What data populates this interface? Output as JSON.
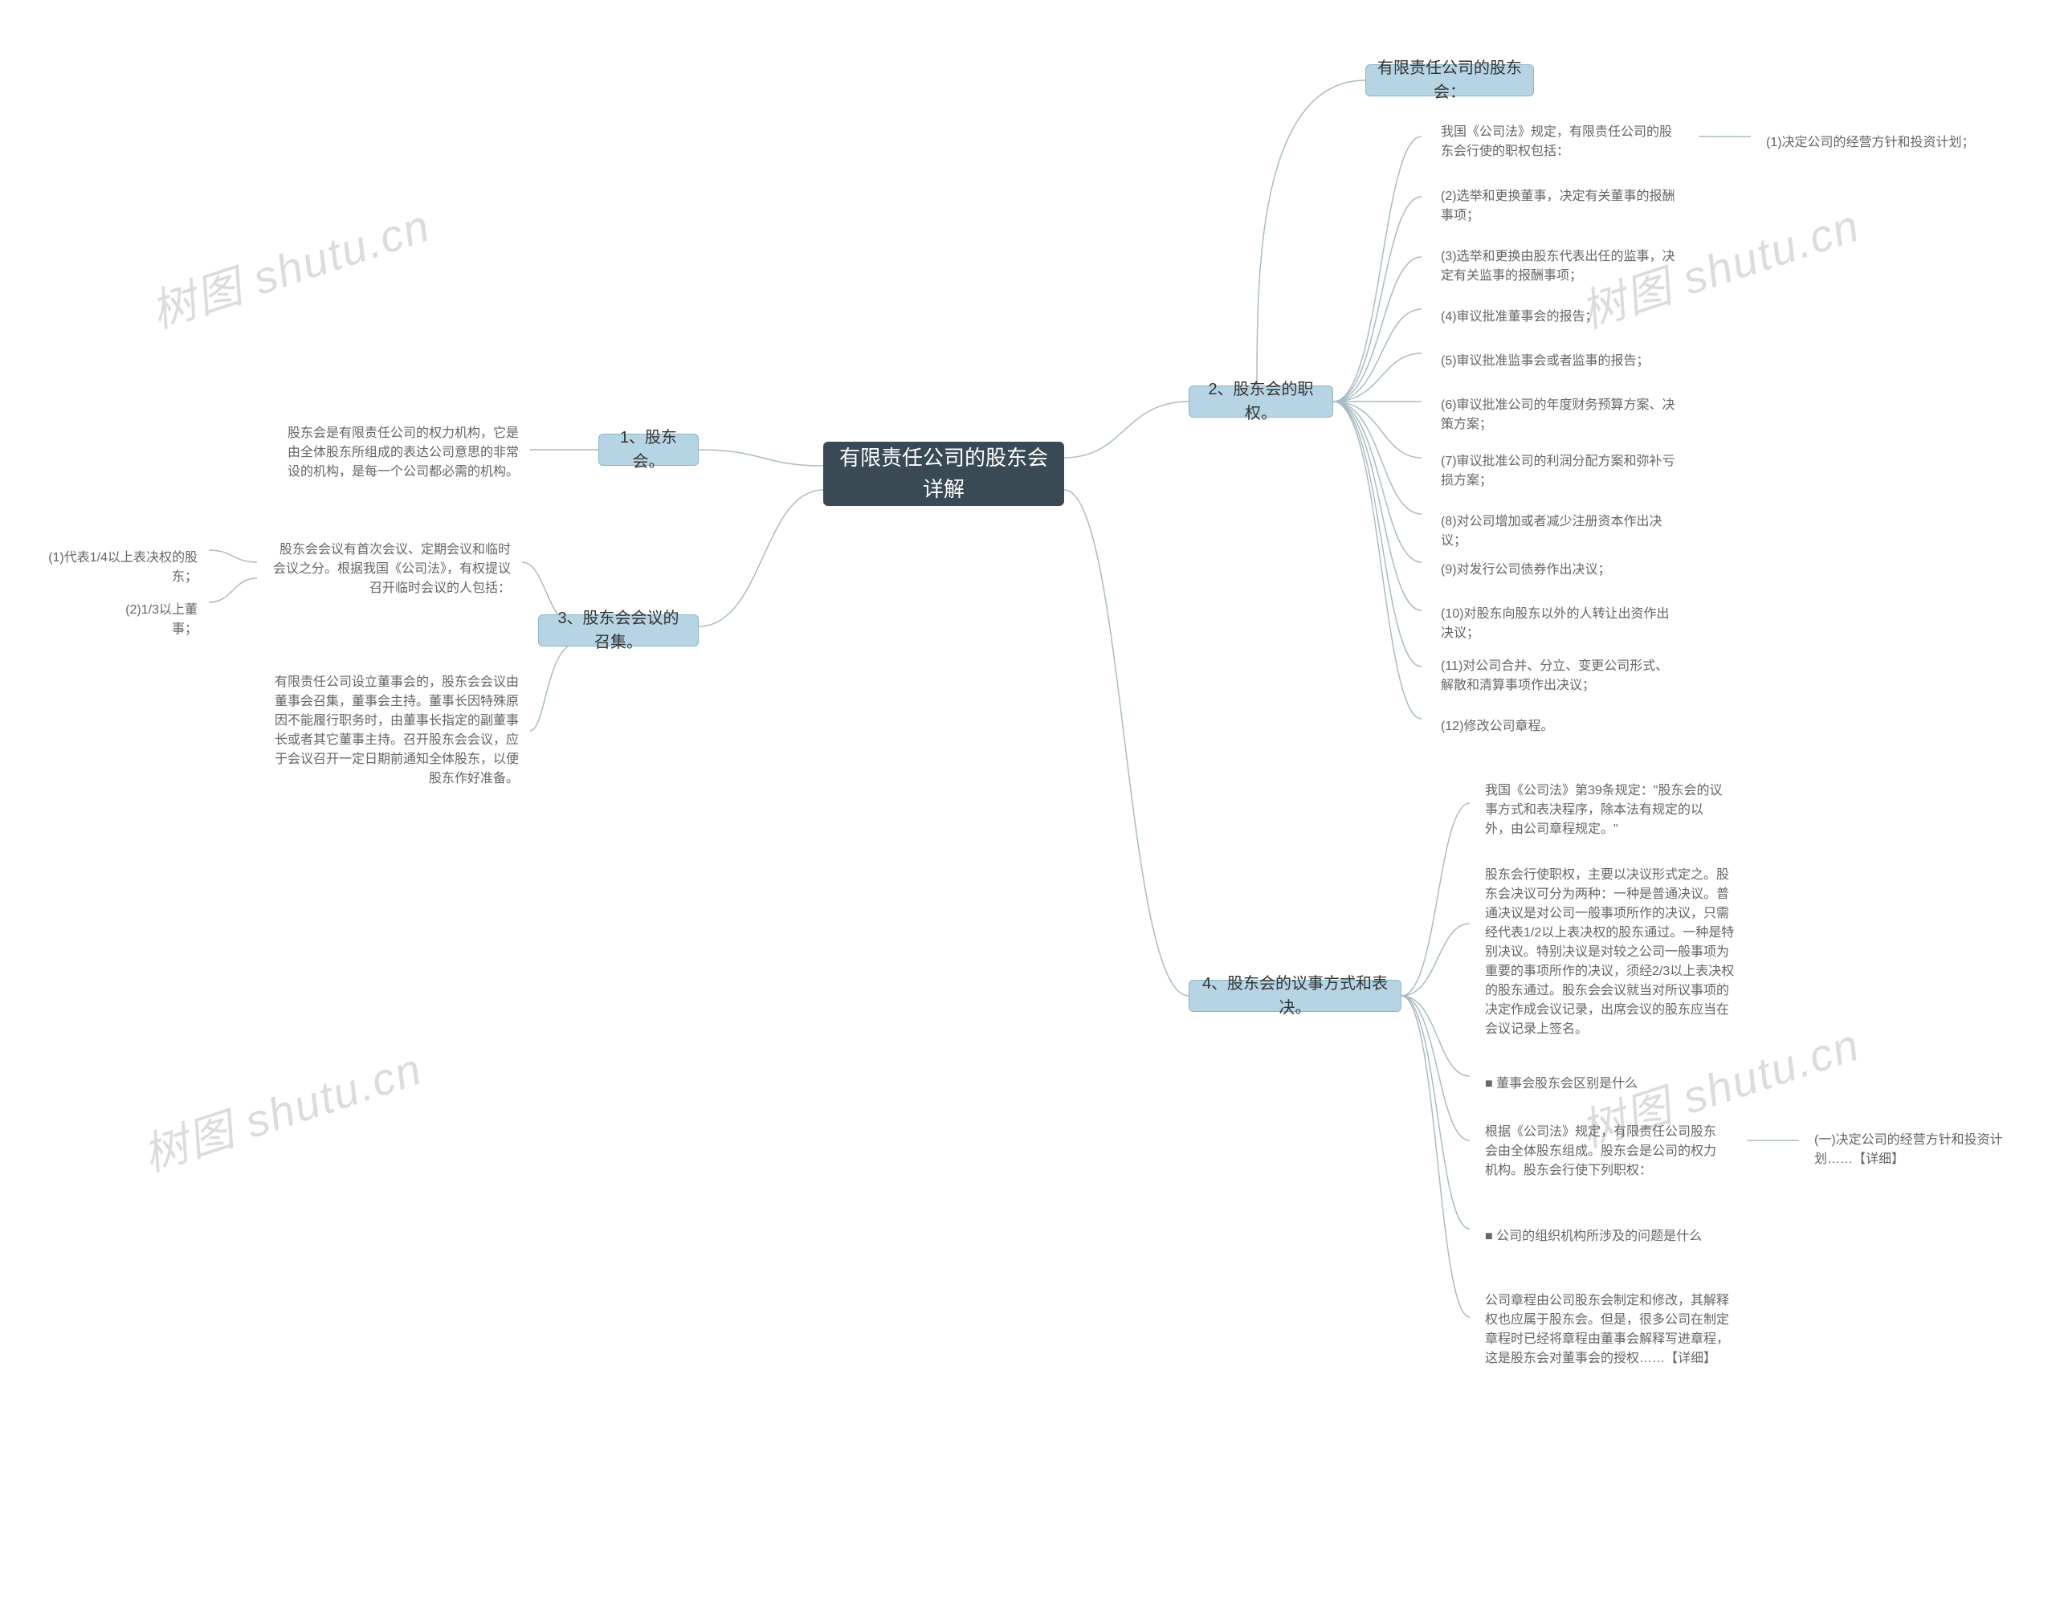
{
  "watermark": "树图 shutu.cn",
  "root": {
    "title": "有限责任公司的股东会详解"
  },
  "branches": {
    "b1": {
      "label": "1、股东会。"
    },
    "b2": {
      "label": "2、股东会的职权。"
    },
    "b3": {
      "label": "3、股东会会议的召集。"
    },
    "b4": {
      "label": "4、股东会的议事方式和表决。"
    },
    "b2a": {
      "label": "有限责任公司的股东会："
    }
  },
  "b1_children": {
    "c1": "股东会是有限责任公司的权力机构，它是由全体股东所组成的表达公司意思的非常设的机构，是每一个公司都必需的机构。"
  },
  "b3_children": {
    "c1": "股东会会议有首次会议、定期会议和临时会议之分。根据我国《公司法》，有权提议召开临时会议的人包括：",
    "c1a": "(1)代表1/4以上表决权的股东；",
    "c1b": "(2)1/3以上董事；",
    "c2": "有限责任公司设立董事会的，股东会会议由董事会召集，董事会主持。董事长因特殊原因不能履行职务时，由董事长指定的副董事长或者其它董事主持。召开股东会会议，应于会议召开一定日期前通知全体股东，以便股东作好准备。"
  },
  "b2_children": {
    "intro": "我国《公司法》规定，有限责任公司的股东会行使的职权包括：",
    "p1": "(1)决定公司的经营方针和投资计划；",
    "p2": "(2)选举和更换董事，决定有关董事的报酬事项；",
    "p3": "(3)选举和更换由股东代表出任的监事，决定有关监事的报酬事项；",
    "p4": "(4)审议批准董事会的报告；",
    "p5": "(5)审议批准监事会或者监事的报告；",
    "p6": "(6)审议批准公司的年度财务预算方案、决策方案；",
    "p7": "(7)审议批准公司的利润分配方案和弥补亏损方案；",
    "p8": "(8)对公司增加或者减少注册资本作出决议；",
    "p9": "(9)对发行公司债券作出决议；",
    "p10": "(10)对股东向股东以外的人转让出资作出决议；",
    "p11": "(11)对公司合并、分立、变更公司形式、解散和清算事项作出决议；",
    "p12": "(12)修改公司章程。"
  },
  "b4_children": {
    "c1": "我国《公司法》第39条规定：\"股东会的议事方式和表决程序，除本法有规定的以外，由公司章程规定。\"",
    "c2": "股东会行使职权，主要以决议形式定之。股东会决议可分为两种：一种是普通决议。普通决议是对公司一般事项所作的决议，只需经代表1/2以上表决权的股东通过。一种是特别决议。特别决议是对较之公司一般事项为重要的事项所作的决议，须经2/3以上表决权的股东通过。股东会会议就当对所议事项的决定作成会议记录，出席会议的股东应当在会议记录上签名。",
    "c3": "■ 董事会股东会区别是什么",
    "c4": "根据《公司法》规定，有限责任公司股东会由全体股东组成。股东会是公司的权力机构。股东会行使下列职权：",
    "c4a": "(一)决定公司的经营方针和投资计划……【详细】",
    "c5": "■ 公司的组织机构所涉及的问题是什么",
    "c6": "公司章程由公司股东会制定和修改，其解释权也应属于股东会。但是，很多公司在制定章程时已经将章程由董事会解释写进章程，这是股东会对董事会的授权……【详细】"
  }
}
